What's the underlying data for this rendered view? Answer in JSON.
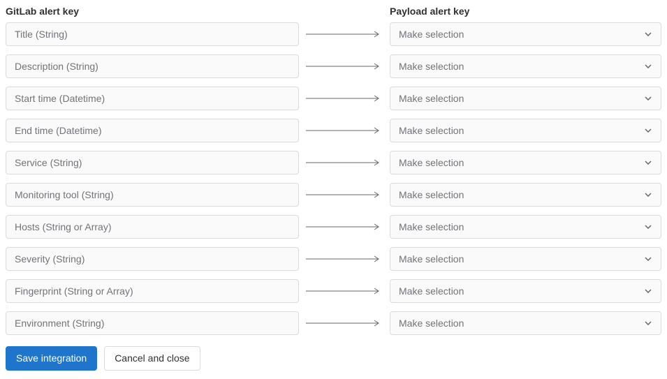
{
  "headers": {
    "gitlab": "GitLab alert key",
    "payload": "Payload alert key"
  },
  "rows": [
    {
      "gitlab_key": "Title (String)",
      "payload_key": "Make selection"
    },
    {
      "gitlab_key": "Description (String)",
      "payload_key": "Make selection"
    },
    {
      "gitlab_key": "Start time (Datetime)",
      "payload_key": "Make selection"
    },
    {
      "gitlab_key": "End time (Datetime)",
      "payload_key": "Make selection"
    },
    {
      "gitlab_key": "Service (String)",
      "payload_key": "Make selection"
    },
    {
      "gitlab_key": "Monitoring tool (String)",
      "payload_key": "Make selection"
    },
    {
      "gitlab_key": "Hosts (String or Array)",
      "payload_key": "Make selection"
    },
    {
      "gitlab_key": "Severity (String)",
      "payload_key": "Make selection"
    },
    {
      "gitlab_key": "Fingerprint (String or Array)",
      "payload_key": "Make selection"
    },
    {
      "gitlab_key": "Environment (String)",
      "payload_key": "Make selection"
    }
  ],
  "buttons": {
    "save": "Save integration",
    "cancel": "Cancel and close"
  }
}
